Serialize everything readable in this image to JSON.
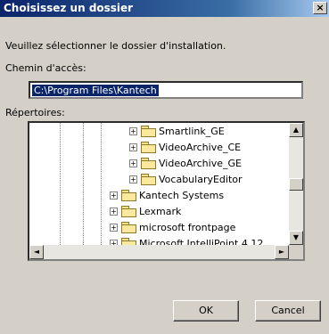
{
  "window": {
    "title": "Choisissez un dossier",
    "close_glyph": "×"
  },
  "prompt": "Veuillez sélectionner le dossier d'installation.",
  "path": {
    "label": "Chemin d'accès:",
    "value": "C:\\Program Files\\Kantech"
  },
  "directories": {
    "label": "Répertoires:",
    "items": [
      {
        "label": "Smartlink_GE"
      },
      {
        "label": "VideoArchive_CE"
      },
      {
        "label": "VideoArchive_GE"
      },
      {
        "label": "VocabularyEditor"
      },
      {
        "label": "Kantech Systems"
      },
      {
        "label": "Lexmark"
      },
      {
        "label": "microsoft frontpage"
      },
      {
        "label": "Microsoft IntelliPoint 4.12"
      }
    ],
    "expander_glyph": "+"
  },
  "scrollbar": {
    "up": "▲",
    "down": "▼",
    "left": "◄",
    "right": "►"
  },
  "buttons": {
    "ok": "OK",
    "cancel": "Cancel"
  },
  "colors": {
    "title_bar": "#0a246a",
    "selection": "#0a246a",
    "dialog_bg": "#d4d0c8"
  }
}
